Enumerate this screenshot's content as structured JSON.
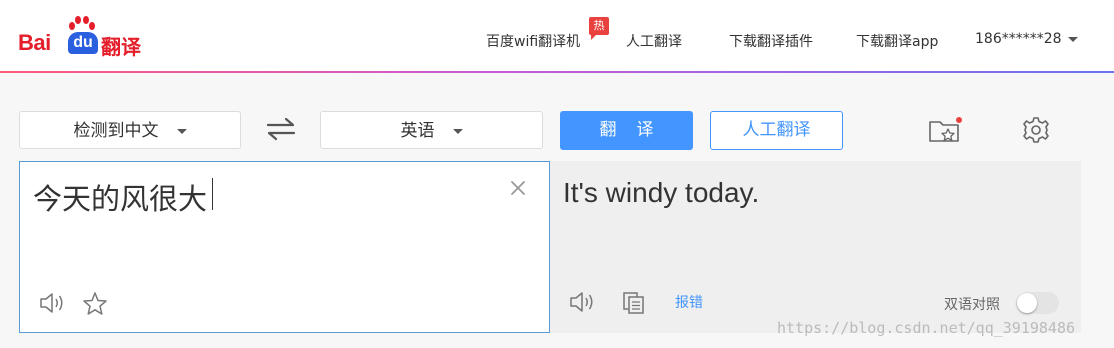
{
  "header": {
    "logo": {
      "bai": "Bai",
      "du": "du",
      "fanyi": "翻译"
    },
    "nav": [
      {
        "label": "百度wifi翻译机",
        "badge": "热"
      },
      {
        "label": "人工翻译"
      },
      {
        "label": "下载翻译插件"
      },
      {
        "label": "下载翻译app"
      }
    ],
    "user": "186******28"
  },
  "toolbar": {
    "source_lang": "检测到中文",
    "swap_icon": "swap-arrows-icon",
    "target_lang": "英语",
    "translate_label": "翻译",
    "human_translate_label": "人工翻译",
    "favorites_icon": "folder-star-icon",
    "settings_icon": "gear-icon"
  },
  "input": {
    "text": "今天的风很大",
    "clear_icon": "close-icon",
    "speaker_icon": "speaker-icon",
    "star_icon": "star-icon"
  },
  "output": {
    "text": "It's windy today.",
    "speaker_icon": "speaker-icon",
    "copy_icon": "copy-icon",
    "report_label": "报错",
    "bilingual_label": "双语对照",
    "bilingual_on": false
  },
  "watermark": "https://blog.csdn.net/qq_39198486",
  "colors": {
    "brand_red": "#e41e2b",
    "brand_blue": "#2a5fe0",
    "accent_blue": "#4395ff",
    "badge_red": "#e8413e"
  }
}
